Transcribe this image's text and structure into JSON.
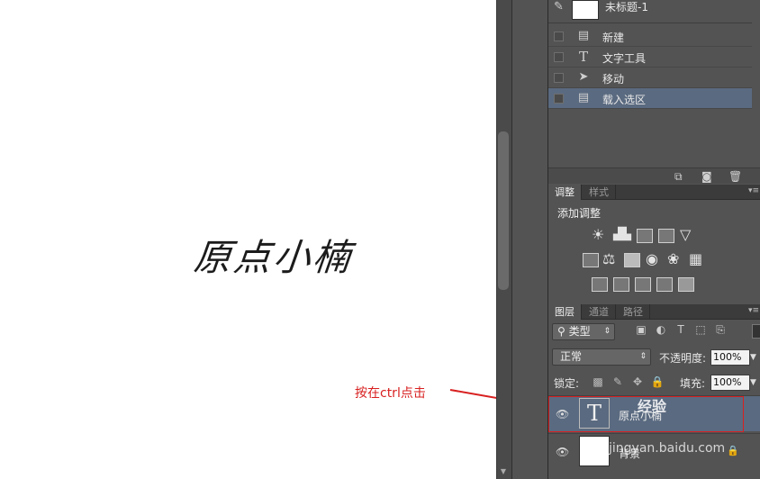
{
  "canvas": {
    "text": "原点小楠",
    "annotation": "按在ctrl点击"
  },
  "history": {
    "snapshot_label": "未标题-1",
    "items": [
      {
        "label": "新建",
        "icon": "document-icon",
        "active": false
      },
      {
        "label": "文字工具",
        "icon": "type-tool-icon",
        "active": false
      },
      {
        "label": "移动",
        "icon": "move-tool-icon",
        "active": false
      },
      {
        "label": "载入选区",
        "icon": "document-icon",
        "active": true
      }
    ]
  },
  "adjustments": {
    "tabs": [
      "调整",
      "样式"
    ],
    "title": "添加调整"
  },
  "layers": {
    "tabs": [
      "图层",
      "通道",
      "路径"
    ],
    "kind_label": "类型",
    "blend_mode": "正常",
    "opacity_label": "不透明度:",
    "opacity_value": "100%",
    "lock_label": "锁定:",
    "fill_label": "填充:",
    "fill_value": "100%",
    "items": [
      {
        "name": "原点小楠",
        "type": "text",
        "selected": true
      },
      {
        "name": "背景",
        "type": "background",
        "selected": false
      }
    ]
  },
  "watermark": {
    "text": "经验",
    "url": "jingyan.baidu.com"
  },
  "colors": {
    "panel_bg": "#535353",
    "selected_row": "#5a6a80",
    "annotation_red": "#d82020"
  }
}
